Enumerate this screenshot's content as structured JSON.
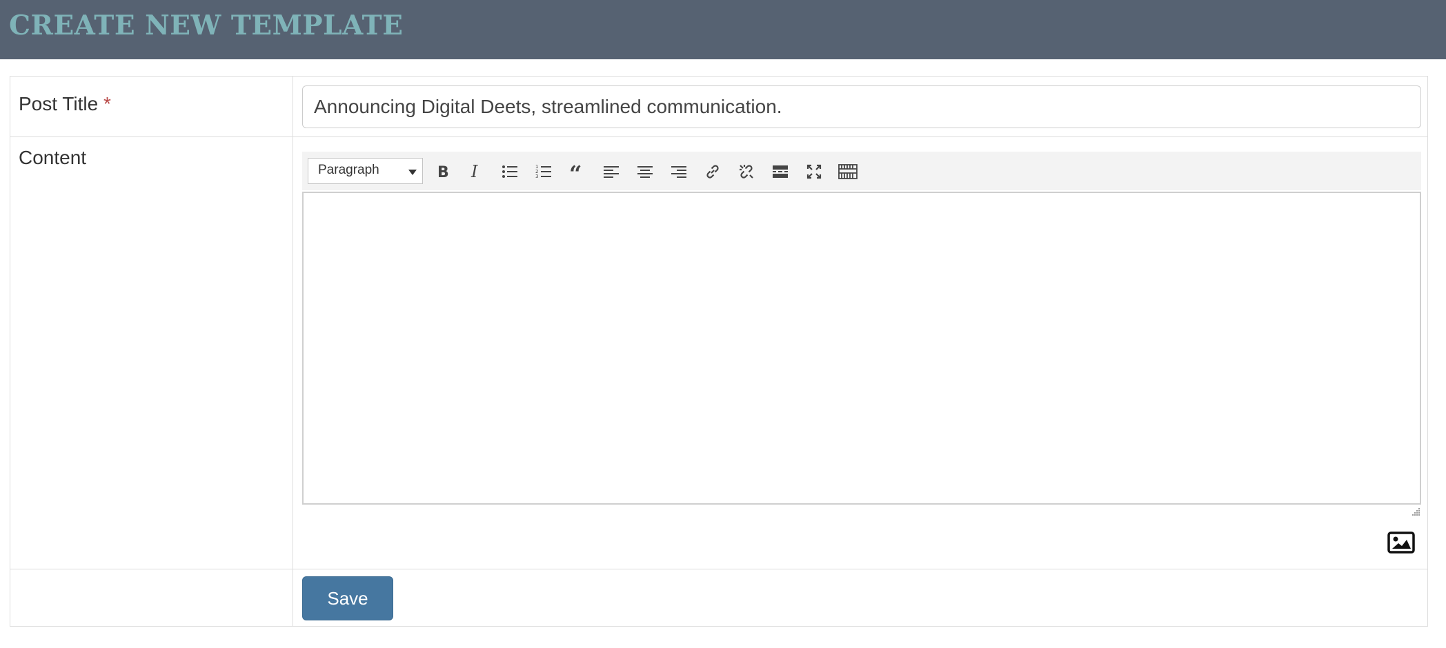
{
  "header": {
    "title": "CREATE NEW TEMPLATE"
  },
  "form": {
    "post_title": {
      "label": "Post Title",
      "required_marker": "*",
      "value": "Announcing Digital Deets, streamlined communication."
    },
    "content": {
      "label": "Content",
      "toolbar": {
        "format_select": "Paragraph",
        "buttons": [
          "bold-icon",
          "italic-icon",
          "bullet-list-icon",
          "numbered-list-icon",
          "blockquote-icon",
          "align-left-icon",
          "align-center-icon",
          "align-right-icon",
          "link-icon",
          "unlink-icon",
          "read-more-icon",
          "fullscreen-icon",
          "toolbar-toggle-icon"
        ]
      },
      "editor_body": "",
      "add_image_icon": "image-icon"
    },
    "save_label": "Save"
  },
  "colors": {
    "header_bg": "#566272",
    "header_title": "#7fb3b8",
    "required": "#b94a48",
    "save_button": "#4677a0"
  }
}
